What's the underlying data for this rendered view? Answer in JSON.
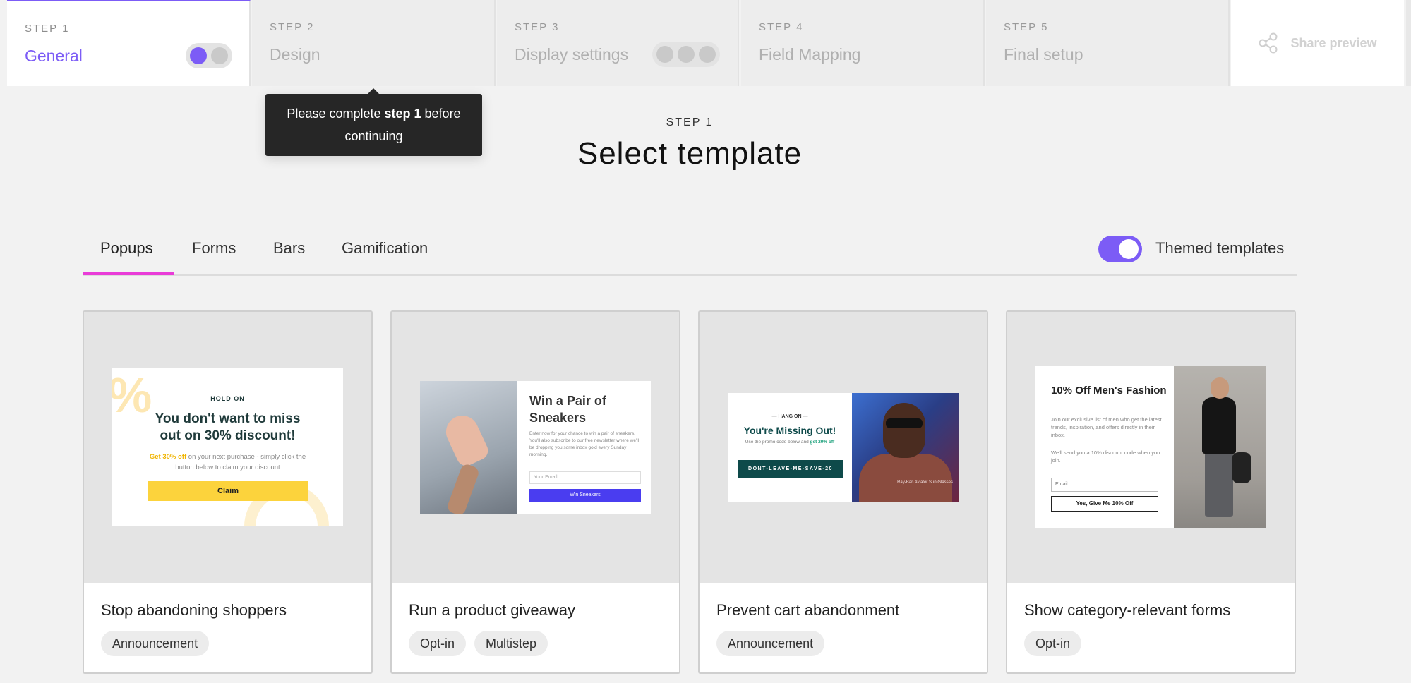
{
  "stepper": {
    "steps": [
      {
        "num": "STEP 1",
        "title": "General"
      },
      {
        "num": "STEP 2",
        "title": "Design"
      },
      {
        "num": "STEP 3",
        "title": "Display settings"
      },
      {
        "num": "STEP 4",
        "title": "Field Mapping"
      },
      {
        "num": "STEP 5",
        "title": "Final setup"
      }
    ],
    "share_label": "Share preview"
  },
  "tooltip": {
    "prefix": "Please complete ",
    "bold": "step 1",
    "suffix": " before continuing"
  },
  "heading": {
    "kicker": "STEP 1",
    "title": "Select template"
  },
  "tabs": {
    "items": [
      "Popups",
      "Forms",
      "Bars",
      "Gamification"
    ],
    "active": "Popups",
    "toggle_label": "Themed templates",
    "toggle_on": true
  },
  "colors": {
    "accent": "#7c5cf6",
    "tab_underline": "#e93cd8"
  },
  "cards": [
    {
      "title": "Stop abandoning shoppers",
      "tags": [
        "Announcement"
      ],
      "preview": {
        "kicker": "HOLD ON",
        "headline": "You don't want to miss out on 30% discount!",
        "highlight": "Get 30% off",
        "body": " on your next purchase - simply click the button below to claim your discount",
        "button": "Claim",
        "decor": "%"
      }
    },
    {
      "title": "Run a product giveaway",
      "tags": [
        "Opt-in",
        "Multistep"
      ],
      "preview": {
        "headline": "Win a Pair of Sneakers",
        "body": "Enter now for your chance to win a pair of sneakers. You'll also subscribe to our free newsletter where we'll be dropping you some inbox gold every Sunday morning.",
        "input_placeholder": "Your Email",
        "button": "Win Sneakers"
      }
    },
    {
      "title": "Prevent cart abandonment",
      "tags": [
        "Announcement"
      ],
      "preview": {
        "kicker": "— HANG ON —",
        "headline": "You're Missing Out!",
        "body": "Use the promo code below and ",
        "highlight": "get 20% off",
        "code": "DONT-LEAVE-ME-SAVE-20",
        "caption": "Ray-Ban Aviator Sun Glasses"
      }
    },
    {
      "title": "Show category-relevant forms",
      "tags": [
        "Opt-in"
      ],
      "preview": {
        "headline": "10% Off Men's Fashion",
        "body": "Join our exclusive list of men who get the latest trends, inspiration, and offers directly in their inbox.",
        "body2": "We'll send you a 10% discount code when you join.",
        "input_placeholder": "Email",
        "button": "Yes, Give Me 10% Off"
      }
    }
  ]
}
